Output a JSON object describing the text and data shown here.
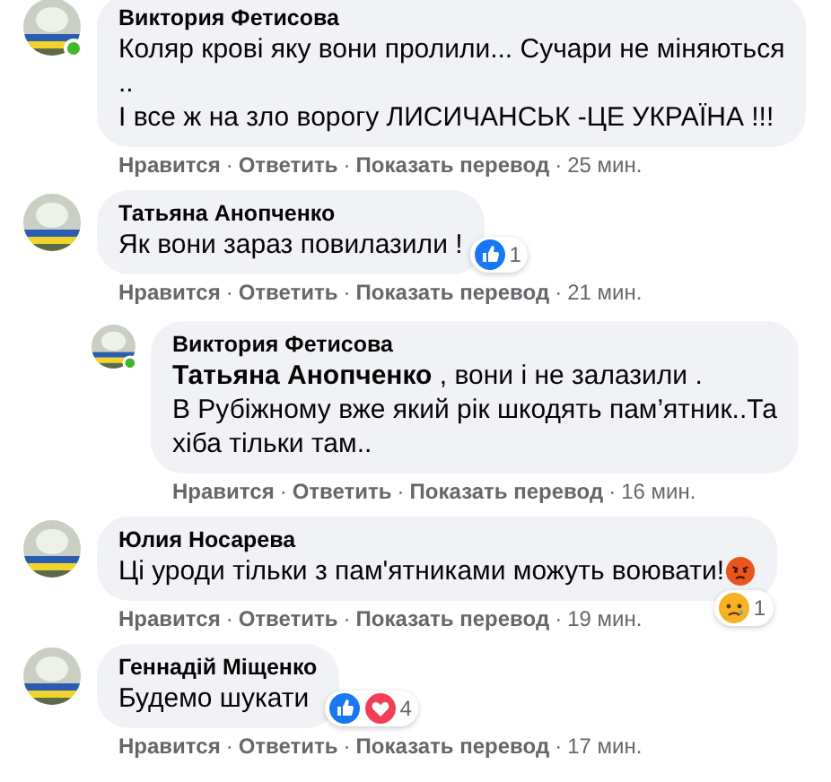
{
  "separator": "·",
  "comments": [
    {
      "author": "Виктория Фетисова",
      "online": true,
      "lines": [
        "Коляр крові яку вони пролили... Сучари не міняються",
        "..",
        "І все ж на зло ворогу ЛИСИЧАНСЬК -ЦЕ УКРАЇНА !!!"
      ],
      "actions": [
        "Нравится",
        "Ответить",
        "Показать перевод"
      ],
      "time": "25 мин."
    },
    {
      "author": "Татьяна Анопченко",
      "online": false,
      "lines": [
        "Як вони зараз повилазили !"
      ],
      "actions": [
        "Нравится",
        "Ответить",
        "Показать перевод"
      ],
      "time": "21 мин.",
      "reactions": {
        "like": true,
        "love": false,
        "sad": false,
        "count": "1"
      },
      "children": [
        {
          "author": "Виктория Фетисова",
          "online": true,
          "lines": [
            "**Татьяна Анопченко** , вони і не залазили .",
            "В Рубіжному вже який рік шкодять пам’ятник..Та",
            "хіба тільки там.."
          ],
          "actions": [
            "Нравится",
            "Ответить",
            "Показать перевод"
          ],
          "time": "16 мин."
        }
      ]
    },
    {
      "author": "Юлия Носарева",
      "online": false,
      "lines": [
        "Ці уроди тільки з пам'ятниками можуть воювати!"
      ],
      "angry_emoji": true,
      "actions": [
        "Нравится",
        "Ответить",
        "Показать перевод"
      ],
      "time": "19 мин.",
      "reactions": {
        "like": false,
        "love": false,
        "sad": true,
        "count": "1"
      }
    },
    {
      "author": "Геннадій Міщенко",
      "online": false,
      "lines": [
        "Будемо шукати"
      ],
      "actions": [
        "Нравится",
        "Ответить",
        "Показать перевод"
      ],
      "time": "17 мин.",
      "reactions": {
        "like": true,
        "love": true,
        "sad": false,
        "count": "4"
      }
    }
  ]
}
